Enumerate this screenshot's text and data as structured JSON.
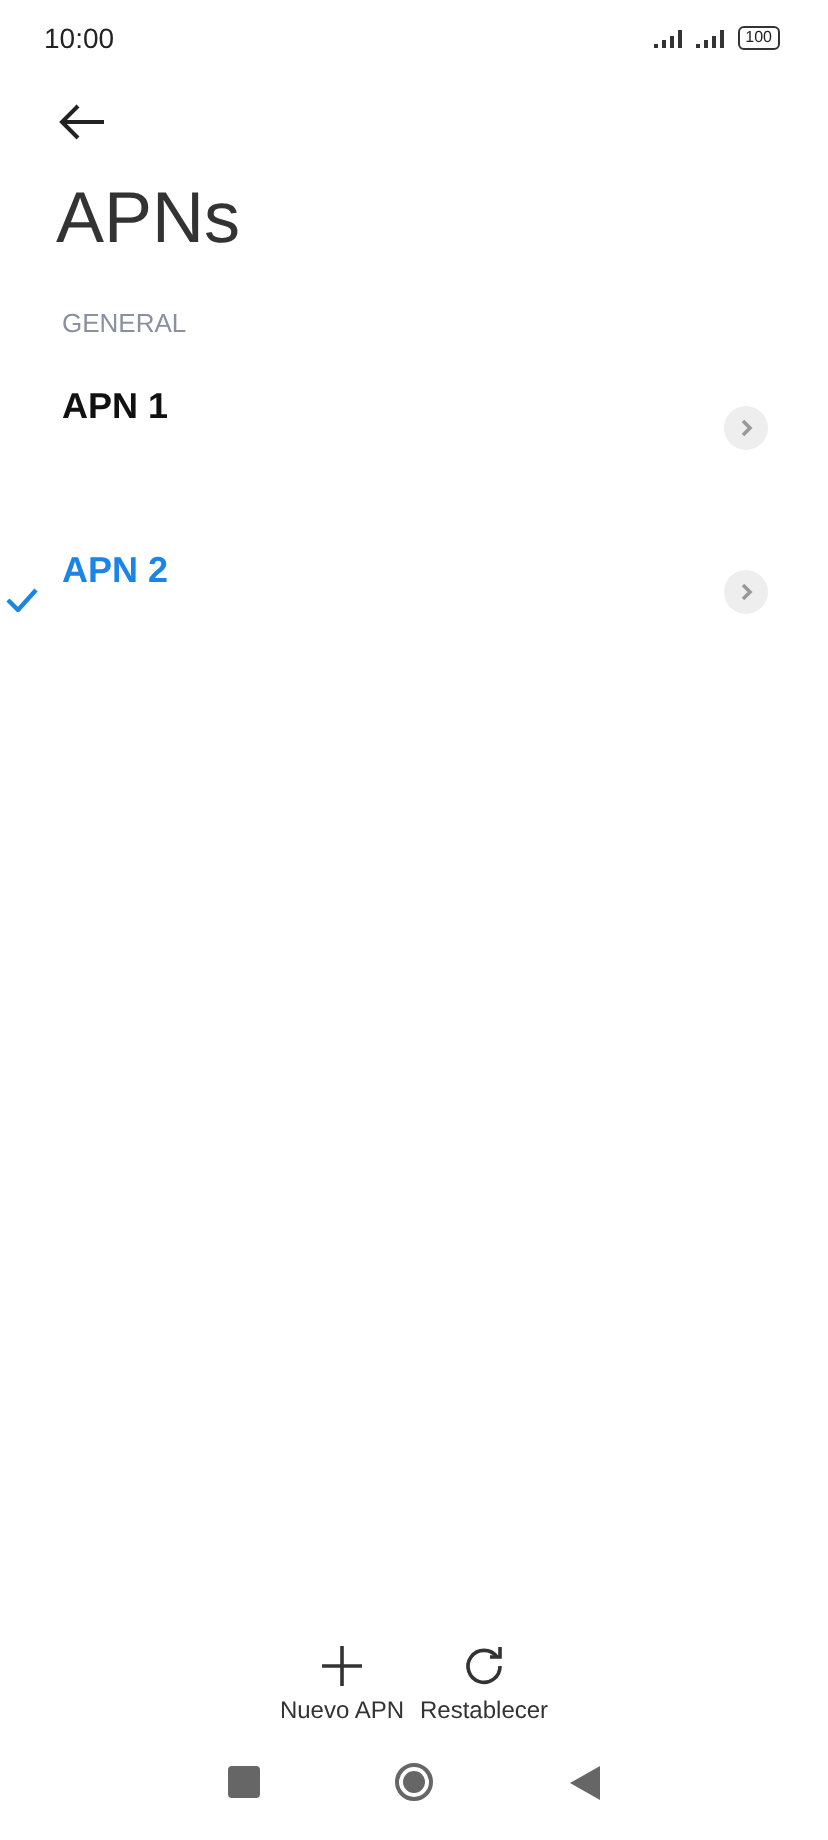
{
  "status_bar": {
    "time": "10:00",
    "battery": "100"
  },
  "title": "APNs",
  "section": "GENERAL",
  "apns": [
    {
      "name": "APN 1",
      "selected": false
    },
    {
      "name": "APN 2",
      "selected": true
    }
  ],
  "actions": [
    {
      "kind": "add",
      "label": "Nuevo APN"
    },
    {
      "kind": "reset",
      "label": "Restablecer"
    }
  ]
}
